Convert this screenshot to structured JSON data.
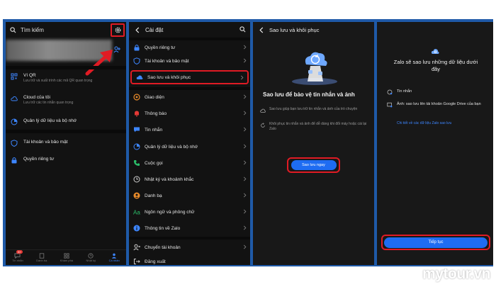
{
  "colors": {
    "accent": "#1e6cf2",
    "highlight": "#e01b24",
    "band": "#1f5aa8"
  },
  "panel1": {
    "search_label": "Tìm kiếm",
    "items": [
      {
        "title": "Ví QR",
        "subtitle": "Lưu trữ và xuất trình các mã QR quan trọng",
        "icon": "qr-icon"
      },
      {
        "title": "Cloud của tôi",
        "subtitle": "Lưu trữ các tin nhắn quan trọng",
        "icon": "cloud-icon"
      },
      {
        "title": "Quản lý dữ liệu và bộ nhớ",
        "subtitle": "",
        "icon": "pie-icon"
      },
      {
        "title": "Tài khoản và bảo mật",
        "subtitle": "",
        "icon": "shield-icon"
      },
      {
        "title": "Quyền riêng tư",
        "subtitle": "",
        "icon": "lock-icon"
      }
    ],
    "nav": [
      {
        "label": "Tin nhắn",
        "badge": "5+"
      },
      {
        "label": "Danh bạ",
        "badge": ""
      },
      {
        "label": "Khám phá",
        "badge": ""
      },
      {
        "label": "Nhật ký",
        "badge": ""
      },
      {
        "label": "Cá nhân",
        "badge": ""
      }
    ]
  },
  "panel2": {
    "title": "Cài đặt",
    "items": [
      {
        "label": "Quyền riêng tư",
        "icon": "lock-icon"
      },
      {
        "label": "Tài khoản và bảo mật",
        "icon": "shield-icon"
      },
      {
        "label": "Sao lưu và khôi phục",
        "icon": "cloud-sync-icon"
      },
      {
        "label": "Giao diện",
        "icon": "palette-icon"
      },
      {
        "label": "Thông báo",
        "icon": "bell-icon"
      },
      {
        "label": "Tin nhắn",
        "icon": "chat-icon"
      },
      {
        "label": "Quản lý dữ liệu và bộ nhớ",
        "icon": "pie-icon"
      },
      {
        "label": "Cuộc gọi",
        "icon": "phone-icon"
      },
      {
        "label": "Nhật ký và khoảnh khắc",
        "icon": "clock-icon"
      },
      {
        "label": "Danh bạ",
        "icon": "contacts-icon"
      },
      {
        "label": "Ngôn ngữ và phông chữ",
        "icon": "font-icon"
      },
      {
        "label": "Thông tin về Zalo",
        "icon": "info-icon"
      },
      {
        "label": "Chuyển tài khoản",
        "icon": "switch-account-icon"
      },
      {
        "label": "Đăng xuất",
        "icon": "logout-icon"
      }
    ]
  },
  "panel3": {
    "title": "Sao lưu và khôi phục",
    "heading": "Sao lưu để bảo vệ tin nhắn và ảnh",
    "bullets": [
      "Sao lưu giúp bạn lưu trữ tin nhắn và ảnh của trò chuyện",
      "Khôi phục tin nhắn và ảnh để dễ dàng khi đổi máy hoặc cài lại Zalo"
    ],
    "button": "Sao lưu ngay"
  },
  "panel4": {
    "heading": "Zalo sẽ sao lưu những dữ liệu dưới đây",
    "items": [
      "Tin nhắn",
      "Ảnh: sao lưu lên tài khoản Google Drive của bạn"
    ],
    "link": "Chi tiết về các dữ liệu Zalo sao lưu",
    "button": "Tiếp tục"
  },
  "watermark": "mytour.vn"
}
